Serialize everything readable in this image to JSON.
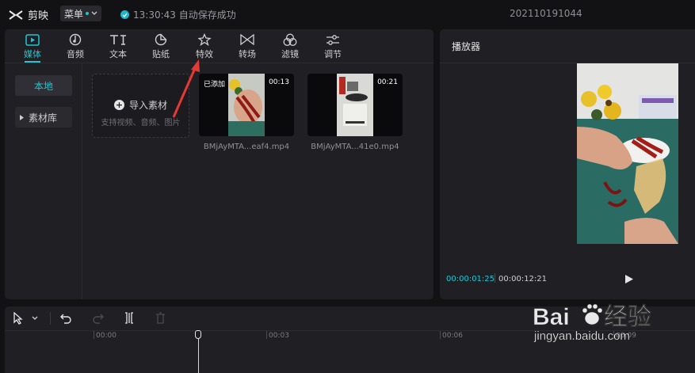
{
  "app": {
    "name": "剪映"
  },
  "topbar": {
    "menu_label": "菜单",
    "save_status": "13:30:43 自动保存成功",
    "project_name": "202110191044"
  },
  "toolbar": {
    "tabs": [
      {
        "label": "媒体",
        "icon": "media-icon",
        "active": true
      },
      {
        "label": "音频",
        "icon": "audio-icon"
      },
      {
        "label": "文本",
        "icon": "text-icon"
      },
      {
        "label": "贴纸",
        "icon": "sticker-icon"
      },
      {
        "label": "特效",
        "icon": "effects-icon"
      },
      {
        "label": "转场",
        "icon": "transition-icon"
      },
      {
        "label": "滤镜",
        "icon": "filter-icon"
      },
      {
        "label": "调节",
        "icon": "adjust-icon"
      }
    ]
  },
  "sidebar": {
    "items": [
      {
        "label": "本地",
        "active": true
      },
      {
        "label": "素材库"
      }
    ]
  },
  "media": {
    "import_label": "导入素材",
    "import_hint": "支持视频、音频、图片",
    "clips": [
      {
        "name": "BMjAyMTA...eaf4.mp4",
        "duration": "00:13",
        "badge": "已添加"
      },
      {
        "name": "BMjAyMTA...41e0.mp4",
        "duration": "00:21"
      }
    ]
  },
  "player": {
    "title": "播放器",
    "current_time": "00:00:01:25",
    "total_time": "00:00:12:21"
  },
  "timeline": {
    "ruler": [
      "00:00",
      "00:03",
      "00:06",
      "00:09"
    ]
  },
  "watermark": {
    "brand": "Baidu经验",
    "url": "jingyan.baidu.com"
  },
  "colors": {
    "accent": "#1fc6d6",
    "annotation_arrow": "#e53935"
  }
}
